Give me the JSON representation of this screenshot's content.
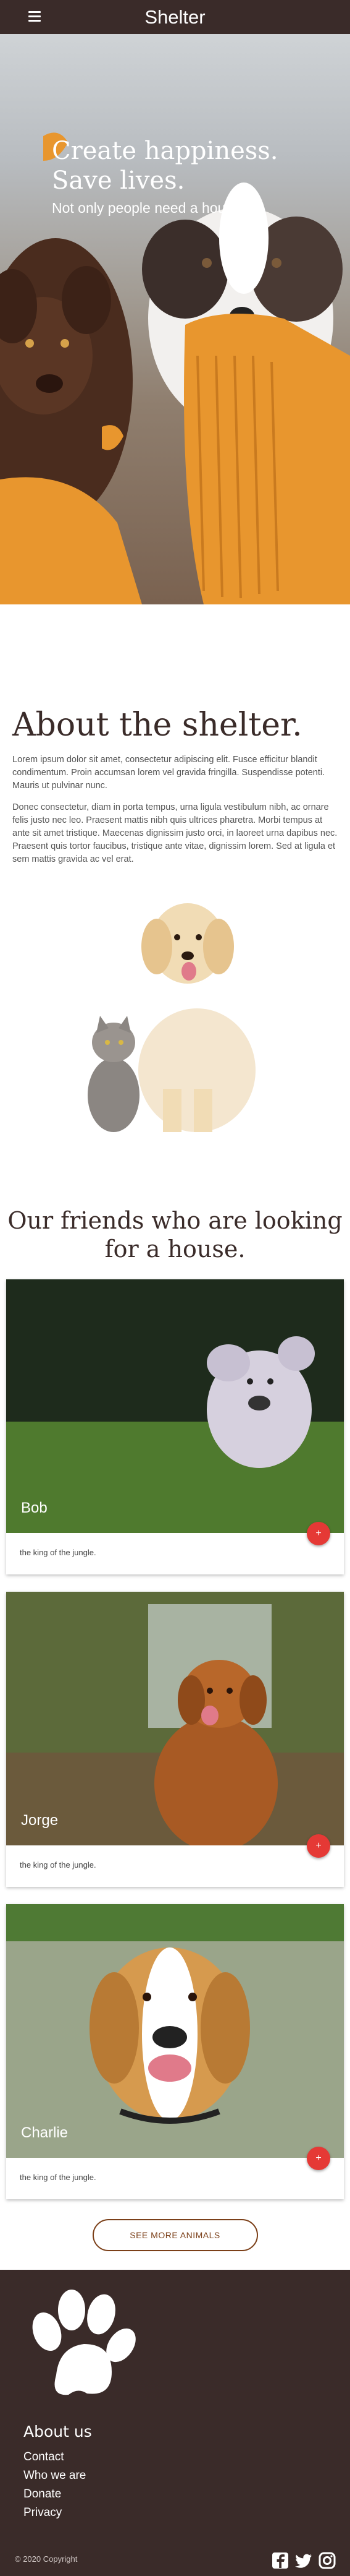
{
  "header": {
    "brand": "Shelter",
    "menu_icon": "hamburger-icon"
  },
  "hero": {
    "title_line1": "Create happiness.",
    "title_line2": "Save lives.",
    "subtitle": "Not only people need a house."
  },
  "about": {
    "title": "About the shelter.",
    "paragraph1": "Lorem ipsum dolor sit amet, consectetur adipiscing elit. Fusce efficitur blandit condimentum. Proin accumsan lorem vel gravida fringilla. Suspendisse potenti. Mauris ut pulvinar nunc.",
    "paragraph2": "Donec consectetur, diam in porta tempus, urna ligula vestibulum nibh, ac ornare felis justo nec leo. Praesent mattis nibh quis ultrices pharetra. Morbi tempus at ante sit amet tristique. Maecenas dignissim justo orci, in laoreet urna dapibus nec. Praesent quis tortor faucibus, tristique ante vitae, dignissim lorem. Sed at ligula et sem mattis gravida ac vel erat."
  },
  "friends": {
    "title": "Our friends who are looking for a house.",
    "cards": [
      {
        "name": "Bob",
        "text": "the king of the jungle.",
        "fab": "+"
      },
      {
        "name": "Jorge",
        "text": "the king of the jungle.",
        "fab": "+"
      },
      {
        "name": "Charlie",
        "text": "the king of the jungle.",
        "fab": "+"
      }
    ],
    "more_button": "SEE MORE ANIMALS"
  },
  "footer": {
    "title": "About us",
    "links": [
      "Contact",
      "Who we are",
      "Donate",
      "Privacy"
    ],
    "copyright": "© 2020 Copyright",
    "social_icons": [
      "facebook-icon",
      "twitter-icon",
      "instagram-icon"
    ]
  },
  "colors": {
    "brand_dark": "#3a2b29",
    "accent": "#7b3f18",
    "fab_red": "#e53935",
    "hero_orange": "#e8962e"
  }
}
